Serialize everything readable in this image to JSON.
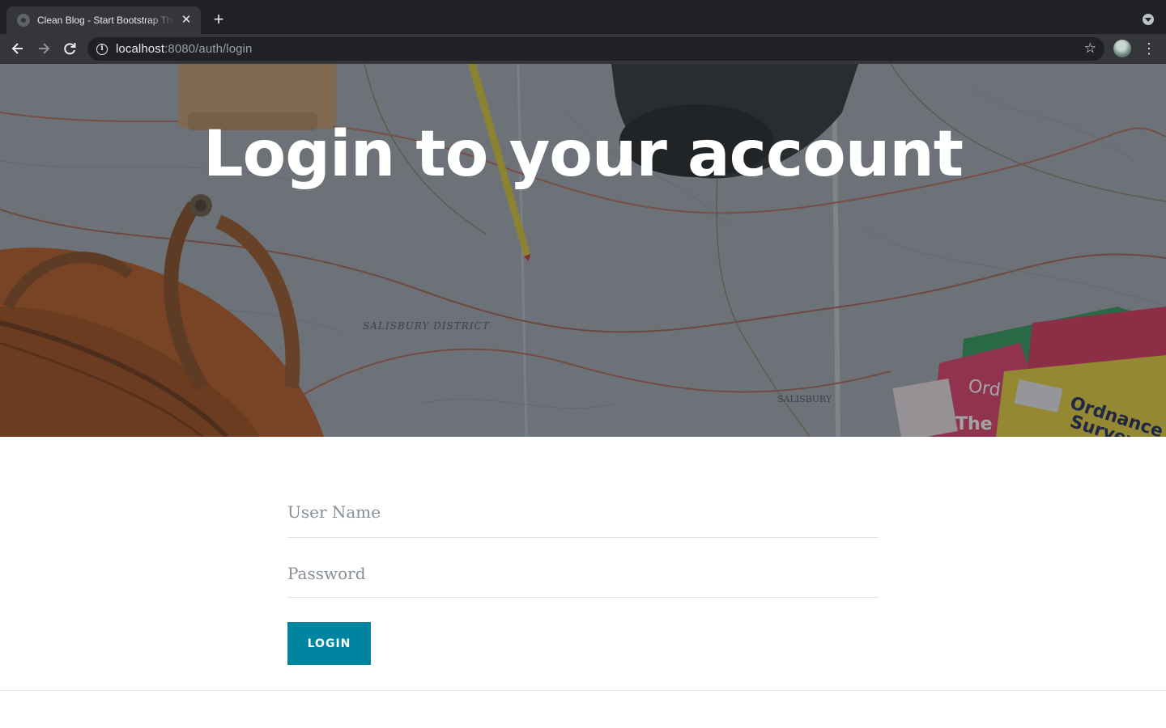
{
  "browser": {
    "tab_title": "Clean Blog - Start Bootstrap Theme",
    "url_host": "localhost",
    "url_rest": ":8080/auth/login",
    "icons": {
      "favicon": "globe-icon",
      "tab_close": "close-icon",
      "new_tab": "plus-icon",
      "tab_search": "chevron-down-icon",
      "back": "arrow-left-icon",
      "forward": "arrow-right-icon",
      "reload": "reload-icon",
      "site_info": "info-icon",
      "bookmark": "star-icon",
      "profile": "avatar",
      "menu": "kebab-menu-icon"
    }
  },
  "page": {
    "heading": "Login to your account",
    "form": {
      "username_placeholder": "User Name",
      "password_placeholder": "Password",
      "submit_label": "Login"
    }
  },
  "colors": {
    "chrome_dark": "#202124",
    "chrome_toolbar": "#35363a",
    "primary_button": "#0085a1",
    "placeholder_text": "#868e96",
    "field_border": "#dee2e6"
  }
}
